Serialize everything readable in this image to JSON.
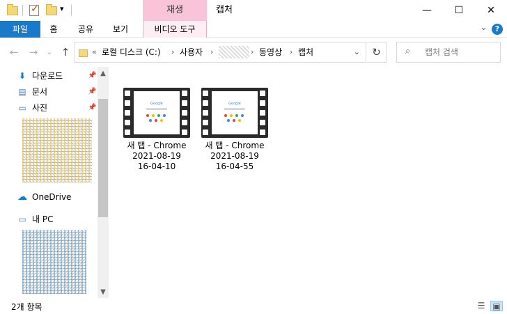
{
  "titlebar": {
    "contextual_tab_header": "재생",
    "window_title": "캡처",
    "minimize_glyph": "—",
    "maximize_glyph": "☐",
    "close_glyph": "✕",
    "qat_dropdown_glyph": "▾"
  },
  "ribbon": {
    "tabs": [
      "파일",
      "홈",
      "공유",
      "보기",
      "비디오 도구"
    ],
    "collapse_glyph": "⌄",
    "help_glyph": "?"
  },
  "nav_buttons": {
    "back": "←",
    "forward": "→",
    "recent": "⌄",
    "up": "↑"
  },
  "address": {
    "overflow": "«",
    "crumbs": [
      "로컬 디스크 (C:)",
      "사용자",
      "",
      "동영상",
      "캡처"
    ],
    "separator": "›",
    "dropdown_glyph": "⌄",
    "refresh_glyph": "↻"
  },
  "search": {
    "placeholder": "캡처 검색"
  },
  "navpane": {
    "quick_access": [
      {
        "label": "다운로드",
        "icon": "download-arrow-icon",
        "pinned": true
      },
      {
        "label": "문서",
        "icon": "document-icon",
        "pinned": true
      },
      {
        "label": "사진",
        "icon": "pictures-icon",
        "pinned": true
      }
    ],
    "onedrive": "OneDrive",
    "this_pc": "내 PC",
    "pin_glyph": "📌",
    "scroll_up": "▲",
    "scroll_down": "▼"
  },
  "files": [
    {
      "name_line1": "새 탭 - Chrome",
      "name_line2": "2021-08-19",
      "name_line3": "16-04-10",
      "logo": "Google"
    },
    {
      "name_line1": "새 탭 - Chrome",
      "name_line2": "2021-08-19",
      "name_line3": "16-04-55",
      "logo": "Google"
    }
  ],
  "status": {
    "item_count": "2개 항목"
  },
  "colors": {
    "file_tab": "#1979ca",
    "contextual_header": "#f9c4d8",
    "folder": "#f8d775"
  }
}
